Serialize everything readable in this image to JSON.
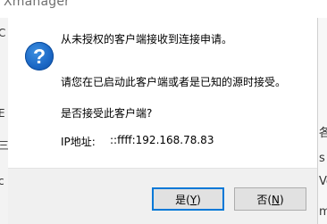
{
  "window": {
    "title": "Xmanager"
  },
  "dialog": {
    "icon": "question-icon",
    "icon_glyph": "?",
    "line1": "从未授权的客户端接收到连接申请。",
    "line2": "请您在已启动此客户端或者是已知的源时接受。",
    "line3": "是否接受此客户端?",
    "ip_label": "IP地址:",
    "ip_value": "::ffff:192.168.78.83",
    "yes_prefix": "是(",
    "yes_key": "Y",
    "yes_suffix": ")",
    "no_prefix": "否(",
    "no_key": "N",
    "no_suffix": ")"
  },
  "background": {
    "left_chars": [
      "C",
      "E",
      "三",
      "c"
    ],
    "right_chars": [
      "各",
      "s",
      "Ve",
      "m"
    ]
  },
  "colors": {
    "accent": "#0078d7",
    "icon_blue": "#1a66c4",
    "footer_bg": "#f0f0f0"
  }
}
